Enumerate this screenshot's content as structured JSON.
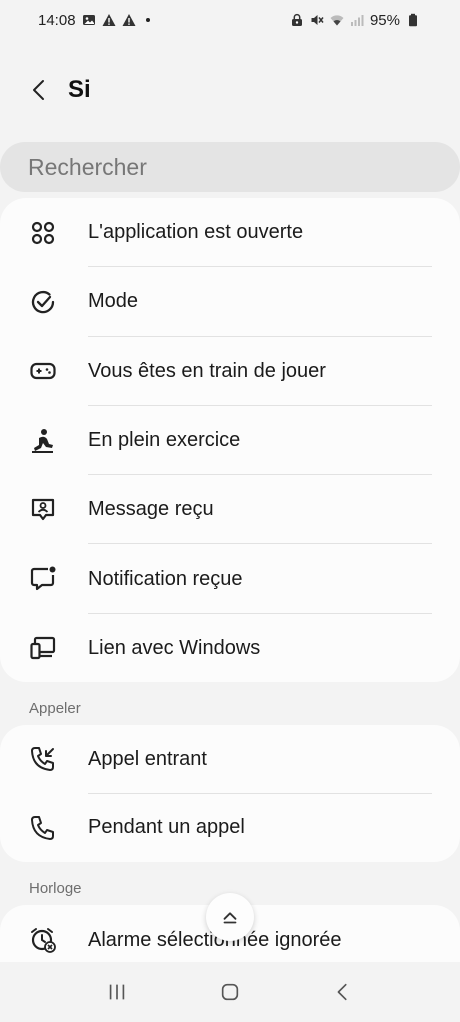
{
  "status_bar": {
    "time": "14:08",
    "battery": "95%",
    "left_icons": [
      "gallery-icon",
      "warning-icon",
      "warning-icon"
    ],
    "right_icons": [
      "lock-icon",
      "mute-icon",
      "wifi-icon",
      "signal-icon",
      "battery-icon"
    ]
  },
  "header": {
    "title": "Si"
  },
  "search": {
    "placeholder": "Rechercher"
  },
  "main_list": [
    {
      "label": "L'application est ouverte",
      "icon": "apps-grid-icon"
    },
    {
      "label": "Mode",
      "icon": "mode-check-icon"
    },
    {
      "label": "Vous êtes en train de jouer",
      "icon": "gamepad-icon"
    },
    {
      "label": "En plein exercice",
      "icon": "exercise-icon"
    },
    {
      "label": "Message reçu",
      "icon": "message-person-icon"
    },
    {
      "label": "Notification reçue",
      "icon": "notification-bubble-icon"
    },
    {
      "label": "Lien avec Windows",
      "icon": "link-windows-icon"
    }
  ],
  "sections": {
    "appeler": {
      "title": "Appeler",
      "items": [
        {
          "label": "Appel entrant",
          "icon": "incoming-call-icon"
        },
        {
          "label": "Pendant un appel",
          "icon": "phone-icon"
        }
      ]
    },
    "horloge": {
      "title": "Horloge",
      "items": [
        {
          "label": "Alarme sélectionnée ignorée",
          "icon": "alarm-dismissed-icon"
        }
      ]
    }
  },
  "nav": {
    "items": [
      "recents-icon",
      "home-icon",
      "back-icon"
    ]
  }
}
